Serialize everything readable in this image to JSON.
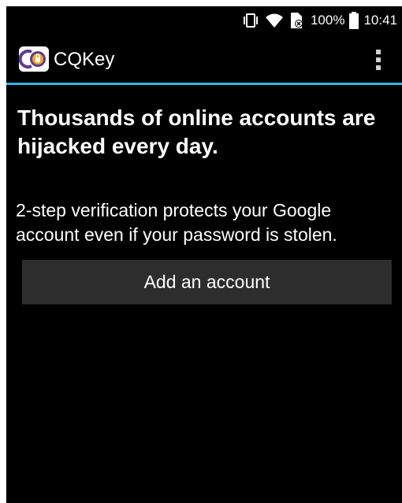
{
  "status_bar": {
    "icons": [
      "vibrate-icon",
      "wifi-icon",
      "sim-card-icon",
      "battery-icon"
    ],
    "battery_percent": "100%",
    "time": "10:41"
  },
  "action_bar": {
    "title": "CQKey",
    "logo_icon": "cqkey-logo-icon",
    "menu_icon": "overflow-menu-icon",
    "accent_color": "#33b5e5"
  },
  "main": {
    "headline": "Thousands of online accounts are hijacked every day.",
    "description": "2-step verification protects your Google account even if your password is stolen.",
    "add_account_label": "Add an account"
  }
}
